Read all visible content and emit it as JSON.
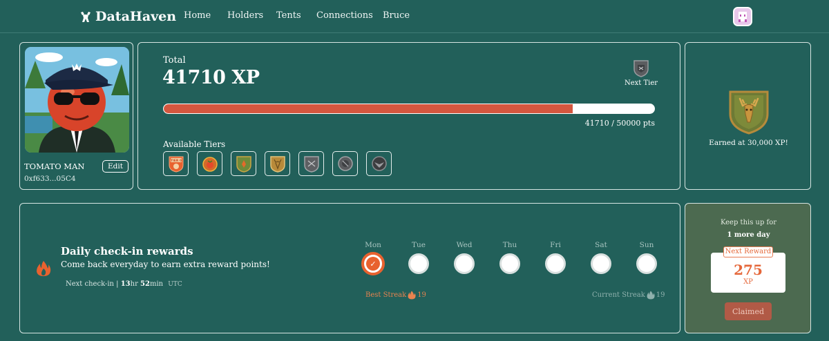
{
  "header": {
    "brand": "DataHaven",
    "nav": [
      {
        "label": "Home"
      },
      {
        "label": "Holders"
      },
      {
        "label": "Tents"
      },
      {
        "label": "Connections"
      },
      {
        "label": "Bruce"
      }
    ]
  },
  "profile": {
    "name": "TOMATO MAN",
    "address": "0xf633...05C4",
    "edit_label": "Edit"
  },
  "xp": {
    "total_label": "Total",
    "total_value": "41710 XP",
    "next_tier_label": "Next Tier",
    "progress_current": 41710,
    "progress_max": 50000,
    "progress_text": "41710 / 50000 pts",
    "available_tiers_label": "Available Tiers",
    "tiers": [
      {
        "icon": "tier-0-badge-icon",
        "color": "#e8622f",
        "label": "TIER 0"
      },
      {
        "icon": "tomato-badge-icon",
        "color": "#d26b2a"
      },
      {
        "icon": "green-shield-badge-icon",
        "color": "#6f8a3a"
      },
      {
        "icon": "gold-stag-badge-icon",
        "color": "#b88a3a"
      },
      {
        "icon": "grey-shield-badge-icon",
        "color": "#6a6a6a"
      },
      {
        "icon": "grey-circle-badge-icon",
        "color": "#5a5a5a"
      },
      {
        "icon": "dark-eagle-badge-icon",
        "color": "#3a3a3a"
      }
    ]
  },
  "earned": {
    "text": "Earned at 30,000 XP!"
  },
  "checkin": {
    "title": "Daily check-in rewards",
    "subtitle": "Come back everyday to earn extra reward points!",
    "next_prefix": "Next check-in |",
    "next_hours": "13",
    "next_hr_unit": "hr",
    "next_minutes": "52",
    "next_min_unit": "min",
    "next_tz": "UTC",
    "days": [
      {
        "name": "Mon",
        "done": true
      },
      {
        "name": "Tue",
        "done": false
      },
      {
        "name": "Wed",
        "done": false
      },
      {
        "name": "Thu",
        "done": false
      },
      {
        "name": "Fri",
        "done": false
      },
      {
        "name": "Sat",
        "done": false
      },
      {
        "name": "Sun",
        "done": false
      }
    ],
    "best_streak_label": "Best Streak",
    "best_streak_value": "19",
    "current_streak_label": "Current Streak",
    "current_streak_value": "19"
  },
  "reward": {
    "keep_text": "Keep this up for",
    "days_text": "1 more day",
    "next_reward_label": "Next Reward",
    "amount": "275",
    "unit": "XP",
    "claimed_label": "Claimed"
  },
  "colors": {
    "background": "#22605a",
    "accent": "#e8622f",
    "progress_fill": "#d4573f",
    "reward_panel": "#4c6a50"
  }
}
